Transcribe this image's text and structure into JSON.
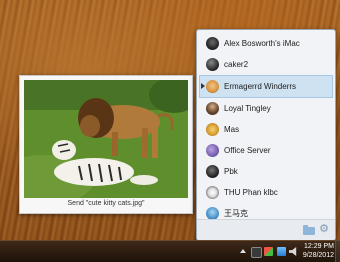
{
  "preview": {
    "caption": "Send \"cute kitty cats.jpg\""
  },
  "people_panel": {
    "contacts": [
      {
        "name": "Alex Bosworth's iMac",
        "avatar_icon": "spiky-dark-avatar-icon",
        "selected": false
      },
      {
        "name": "caker2",
        "avatar_icon": "dark-avatar-icon",
        "selected": false
      },
      {
        "name": "Ermagerrd Winderrs",
        "avatar_icon": "cartoon-face-avatar-icon",
        "selected": true
      },
      {
        "name": "Loyal Tingley",
        "avatar_icon": "person-avatar-icon",
        "selected": false
      },
      {
        "name": "Mas",
        "avatar_icon": "dog-avatar-icon",
        "selected": false
      },
      {
        "name": "Office Server",
        "avatar_icon": "server-avatar-icon",
        "selected": false
      },
      {
        "name": "Pbk",
        "avatar_icon": "dark-avatar-icon",
        "selected": false
      },
      {
        "name": "THU Phan klbc",
        "avatar_icon": "panda-avatar-icon",
        "selected": false
      },
      {
        "name": "王马克",
        "avatar_icon": "blue-avatar-icon",
        "selected": false
      }
    ]
  },
  "taskbar": {
    "time": "12:29 PM",
    "date": "9/28/2012"
  }
}
